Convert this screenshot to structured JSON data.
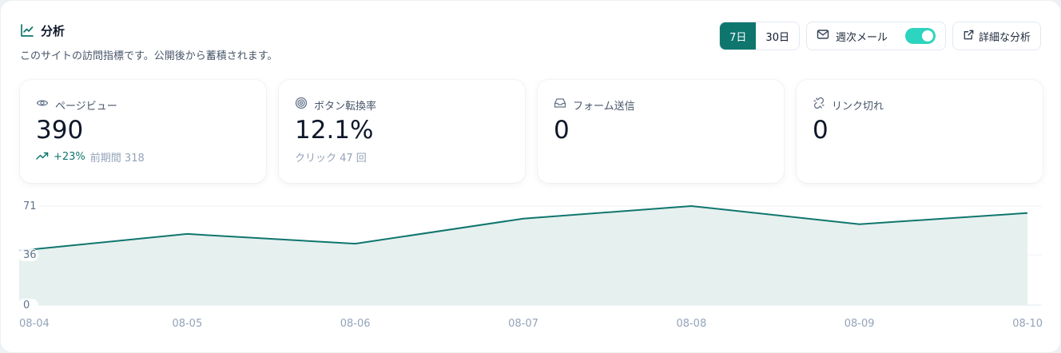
{
  "header": {
    "title": "分析",
    "subtitle": "このサイトの訪問指標です。公開後から蓄積されます。"
  },
  "controls": {
    "range_options": [
      "7日",
      "30日"
    ],
    "selected_range": "7日",
    "weekly_mail_label": "週次メール",
    "weekly_mail_enabled": true,
    "details_label": "詳細な分析"
  },
  "metrics": [
    {
      "label": "ページビュー",
      "value": "390",
      "trend": "+23%",
      "sub": "前期間 318",
      "icon": "eye-icon"
    },
    {
      "label": "ボタン転換率",
      "value": "12.1%",
      "sub": "クリック 47 回",
      "icon": "target-icon"
    },
    {
      "label": "フォーム送信",
      "value": "0",
      "icon": "inbox-icon"
    },
    {
      "label": "リンク切れ",
      "value": "0",
      "icon": "broken-link-icon"
    }
  ],
  "colors": {
    "accent": "#0f766e",
    "toggle_on": "#2dd4bf",
    "area_fill": "#e6f0ee"
  },
  "chart_data": {
    "type": "area",
    "x": [
      "08-04",
      "08-05",
      "08-06",
      "08-07",
      "08-08",
      "08-09",
      "08-10"
    ],
    "values": [
      39,
      51,
      44,
      62,
      71,
      58,
      66
    ],
    "y_ticks": [
      0,
      36,
      71
    ],
    "ylim": [
      0,
      71
    ],
    "grid": true
  }
}
